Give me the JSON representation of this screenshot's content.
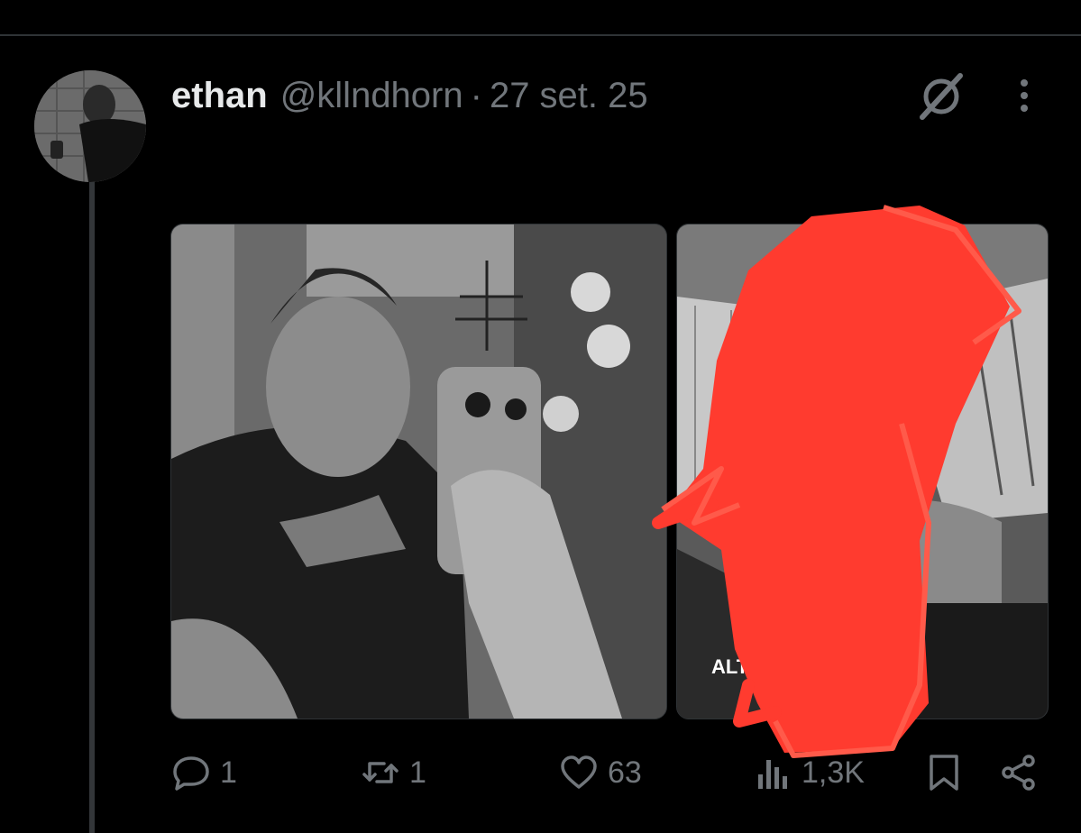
{
  "post": {
    "author_name": "ethan",
    "author_handle": "@kllndhorn",
    "separator": "·",
    "date": "27 set. 25",
    "media": [
      {
        "description_icon": "photo",
        "alt_label": ""
      },
      {
        "description_icon": "photo",
        "alt_label": "ALT"
      }
    ],
    "actions": {
      "replies": "1",
      "reposts": "1",
      "likes": "63",
      "views": "1,3K"
    }
  },
  "colors": {
    "background": "#000000",
    "text_primary": "#e7e9ea",
    "text_secondary": "#71767b",
    "divider": "#2f3336",
    "scribble": "#ff3b2f"
  },
  "icons": [
    "grok-icon",
    "more-icon",
    "reply-icon",
    "retweet-icon",
    "like-icon",
    "views-icon",
    "bookmark-icon",
    "share-icon"
  ]
}
